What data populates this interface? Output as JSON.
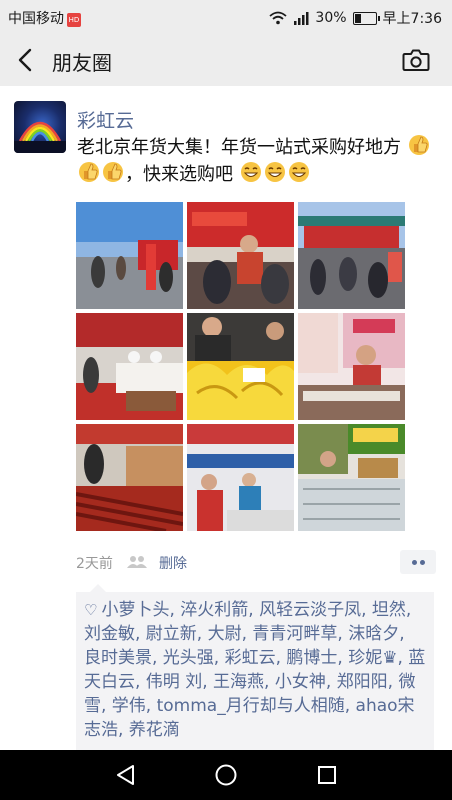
{
  "status_bar": {
    "carrier": "中国移动",
    "carrier_badge": "HD",
    "signal": "4G",
    "battery": "30%",
    "time": "早上7:36"
  },
  "navbar": {
    "title": "朋友圈",
    "back_icon": "back-chevron-icon",
    "camera_icon": "camera-icon"
  },
  "post": {
    "username": "彩虹云",
    "text_part1": "老北京年货大集！年货一站式采购好地方",
    "text_part2": "，快来选购吧",
    "thumb_emoji_count": 3,
    "grin_emoji_count": 3,
    "photo_count": 9,
    "time": "2天前",
    "delete_label": "删除",
    "likes": "小萝卜头, 淬火利箭, 风轻云淡子凤, 坦然, 刘金敏, 尉立新, 大尉, 青青河畔草, 沫晗夕, 良时美景, 光头强, 彩虹云, 鹏博士, 珍妮♛, 蓝天白云, 伟明 刘, 王海燕, 小女神, 郑阳阳, 微雪, 学伟, tomma_月行却与人相随, ahao宋志浩, 养花滴"
  },
  "colors": {
    "link_blue": "#576b95",
    "bar_bg": "#ededed",
    "likes_bg": "#f3f3f5"
  }
}
